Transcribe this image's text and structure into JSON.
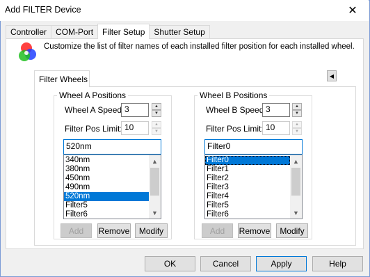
{
  "window": {
    "title": "Add FILTER Device",
    "close_glyph": "✕"
  },
  "tabs": [
    {
      "label": "Controller"
    },
    {
      "label": "COM-Port"
    },
    {
      "label": "Filter Setup",
      "active": true
    },
    {
      "label": "Shutter Setup"
    }
  ],
  "description": "Customize the list of filter names of each installed filter position for each installed wheel.",
  "icon": "rgb-filter-icon",
  "inner_tab": {
    "label": "Filter Wheels",
    "scroll_glyph": "◀"
  },
  "wheel_a": {
    "legend": "Wheel A Positions",
    "speed_label": "Wheel A Speed:",
    "speed_value": "3",
    "limit_label": "Filter Pos Limit:",
    "limit_value": "10",
    "name_value": "520nm",
    "items": [
      "340nm",
      "380nm",
      "450nm",
      "490nm",
      "520nm",
      "Filter5",
      "Filter6"
    ],
    "selected_index": 4,
    "buttons": {
      "add": "Add",
      "remove": "Remove",
      "modify": "Modify"
    }
  },
  "wheel_b": {
    "legend": "Wheel B Positions",
    "speed_label": "Wheel B Speed:",
    "speed_value": "3",
    "limit_label": "Filter Pos Limit:",
    "limit_value": "10",
    "name_value": "Filter0",
    "items": [
      "Filter0",
      "Filter1",
      "Filter2",
      "Filter3",
      "Filter4",
      "Filter5",
      "Filter6"
    ],
    "selected_index": 0,
    "buttons": {
      "add": "Add",
      "remove": "Remove",
      "modify": "Modify"
    }
  },
  "footer": {
    "ok": "OK",
    "cancel": "Cancel",
    "apply": "Apply",
    "help": "Help"
  },
  "colors": {
    "accent": "#0078d7",
    "selection": "#0078d7",
    "window_bg": "#f0f0f0"
  }
}
